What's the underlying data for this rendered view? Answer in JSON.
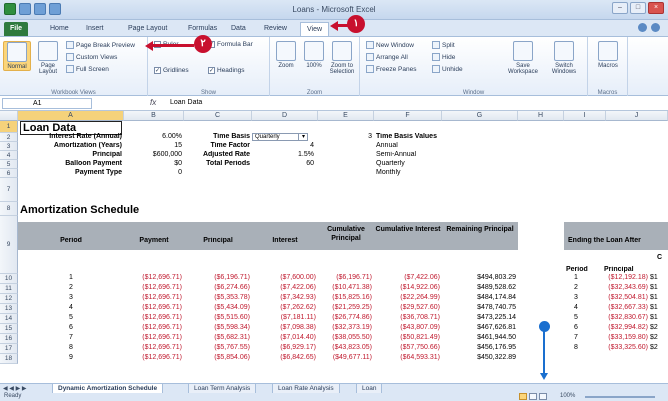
{
  "window": {
    "title": "Loans - Microsoft Excel"
  },
  "tabs": [
    "File",
    "Home",
    "Insert",
    "Page Layout",
    "Formulas",
    "Data",
    "Review",
    "View"
  ],
  "ribbon": {
    "workbook_views": {
      "label": "Workbook Views",
      "normal": "Normal",
      "page_layout": "Page Layout",
      "page_break_preview": "Page Break Preview",
      "custom_views": "Custom Views",
      "full_screen": "Full Screen"
    },
    "show": {
      "label": "Show",
      "ruler": "Ruler",
      "formula_bar": "Formula Bar",
      "gridlines": "Gridlines",
      "headings": "Headings"
    },
    "zoom": {
      "label": "Zoom",
      "zoom": "Zoom",
      "hundred": "100%",
      "to_selection": "Zoom to Selection"
    },
    "window": {
      "label": "Window",
      "new_window": "New Window",
      "arrange_all": "Arrange All",
      "freeze_panes": "Freeze Panes",
      "split": "Split",
      "hide": "Hide",
      "unhide": "Unhide",
      "save_workspace": "Save Workspace",
      "switch_windows": "Switch Windows"
    },
    "macros": {
      "label": "Macros",
      "macros": "Macros"
    }
  },
  "callouts": {
    "one": "١",
    "two": "٢"
  },
  "formula_bar": {
    "name_box": "A1",
    "fx": "fx",
    "content": "Loan Data"
  },
  "columns": [
    "A",
    "B",
    "C",
    "D",
    "E",
    "F",
    "G",
    "H",
    "I",
    "J"
  ],
  "rows": [
    "1",
    "2",
    "3",
    "4",
    "5",
    "6",
    "7",
    "8",
    "9",
    "10",
    "11",
    "12",
    "13",
    "14",
    "15",
    "16",
    "17",
    "18"
  ],
  "loan_data": {
    "title": "Loan Data",
    "labels": [
      "Interest Rate (Annual)",
      "Amortization (Years)",
      "Principal",
      "Balloon Payment",
      "Payment Type"
    ],
    "values": [
      "6.00%",
      "15",
      "$600,000",
      "$0",
      "0"
    ],
    "labels2": [
      "Time Basis",
      "Time Factor",
      "Adjusted Rate",
      "Total Periods"
    ],
    "values2": [
      "Quarterly",
      "4",
      "1.5%",
      "60"
    ],
    "basis_title": "Time Basis Values",
    "basis_num": "3",
    "basis_values": [
      "Annual",
      "Semi-Annual",
      "Quarterly",
      "Monthly"
    ]
  },
  "amortization": {
    "title": "Amortization Schedule",
    "headers": [
      "Period",
      "Payment",
      "Principal",
      "Interest",
      "Cumulative Principal",
      "Cumulative Interest",
      "Remaining Principal"
    ],
    "rows": [
      [
        "1",
        "($12,696.71)",
        "($6,196.71)",
        "($7,600.00)",
        "($6,196.71)",
        "($7,422.06)",
        "$494,803.29"
      ],
      [
        "2",
        "($12,696.71)",
        "($6,274.66)",
        "($7,422.06)",
        "($10,471.38)",
        "($14,922.06)",
        "$489,528.62"
      ],
      [
        "3",
        "($12,696.71)",
        "($5,353.78)",
        "($7,342.93)",
        "($15,825.16)",
        "($22,264.99)",
        "$484,174.84"
      ],
      [
        "4",
        "($12,696.71)",
        "($5,434.09)",
        "($7,262.62)",
        "($21,259.25)",
        "($29,527.60)",
        "$478,740.75"
      ],
      [
        "5",
        "($12,696.71)",
        "($5,515.60)",
        "($7,181.11)",
        "($26,774.86)",
        "($36,708.71)",
        "$473,225.14"
      ],
      [
        "6",
        "($12,696.71)",
        "($5,598.34)",
        "($7,098.38)",
        "($32,373.19)",
        "($43,807.09)",
        "$467,626.81"
      ],
      [
        "7",
        "($12,696.71)",
        "($5,682.31)",
        "($7,014.40)",
        "($38,055.50)",
        "($50,821.49)",
        "$461,944.50"
      ],
      [
        "8",
        "($12,696.71)",
        "($5,767.55)",
        "($6,929.17)",
        "($43,823.05)",
        "($57,750.66)",
        "$456,176.95"
      ],
      [
        "9",
        "($12,696.71)",
        "($5,854.06)",
        "($6,842.65)",
        "($49,677.11)",
        "($64,593.31)",
        "$450,322.89"
      ]
    ]
  },
  "ending_loan": {
    "title": "Ending the Loan After",
    "col_c": "C",
    "headers": [
      "Period",
      "Principal"
    ],
    "rows": [
      [
        "1",
        "($12,192.18)",
        "$1"
      ],
      [
        "2",
        "($32,343.69)",
        "$1"
      ],
      [
        "3",
        "($32,504.81)",
        "$1"
      ],
      [
        "4",
        "($32,667.33)",
        "$1"
      ],
      [
        "5",
        "($32,830.67)",
        "$1"
      ],
      [
        "6",
        "($32,994.82)",
        "$2"
      ],
      [
        "7",
        "($33,159.80)",
        "$2"
      ],
      [
        "8",
        "($33,325.60)",
        "$2"
      ]
    ]
  },
  "sheet_tabs": [
    "Dynamic Amortization Schedule",
    "Loan Term Analysis",
    "Loan Rate Analysis",
    "Loan"
  ],
  "status": {
    "ready": "Ready",
    "zoom": "100%"
  }
}
